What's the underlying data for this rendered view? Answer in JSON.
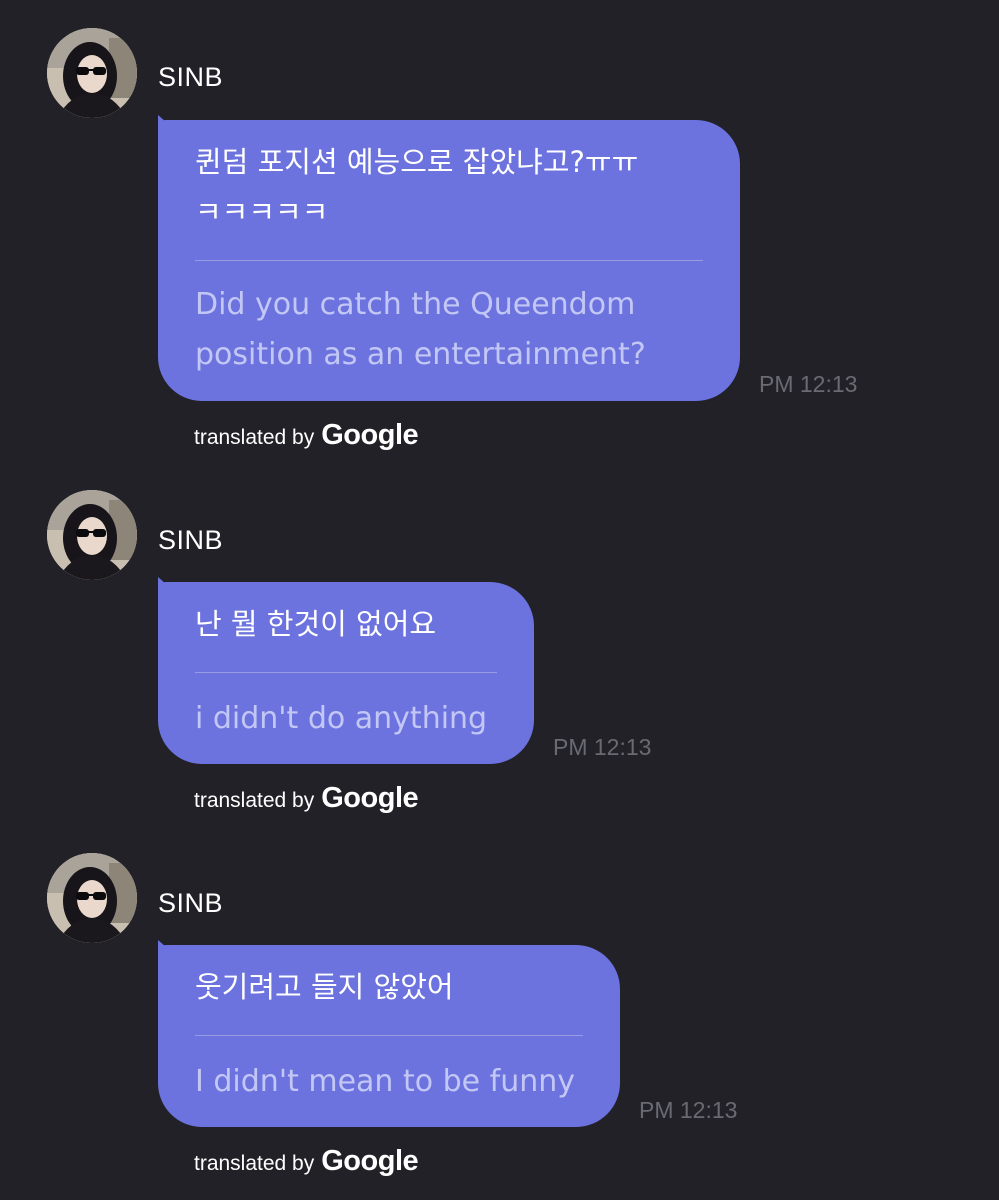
{
  "messages": [
    {
      "sender": "SINB",
      "avatar_icon": "profile-photo-avatar",
      "original_text": "퀸덤 포지션 예능으로 잡았냐고?ㅠㅠ\nㅋㅋㅋㅋㅋ",
      "translated_text": "Did you catch the Queendom\nposition as an entertainment?",
      "time": "PM 12:13",
      "credit_prefix": "translated by",
      "credit_brand": "Google"
    },
    {
      "sender": "SINB",
      "avatar_icon": "profile-photo-avatar",
      "original_text": "난 뭘 한것이 없어요",
      "translated_text": "i didn't do anything",
      "time": "PM 12:13",
      "credit_prefix": "translated by",
      "credit_brand": "Google"
    },
    {
      "sender": "SINB",
      "avatar_icon": "profile-photo-avatar",
      "original_text": "웃기려고 들지 않았어",
      "translated_text": "I didn't mean to be funny",
      "time": "PM 12:13",
      "credit_prefix": "translated by",
      "credit_brand": "Google"
    }
  ],
  "colors": {
    "background": "#212127",
    "bubble": "#6c73de",
    "translated_text": "#c3c7f5",
    "timestamp": "#6a6a74"
  }
}
